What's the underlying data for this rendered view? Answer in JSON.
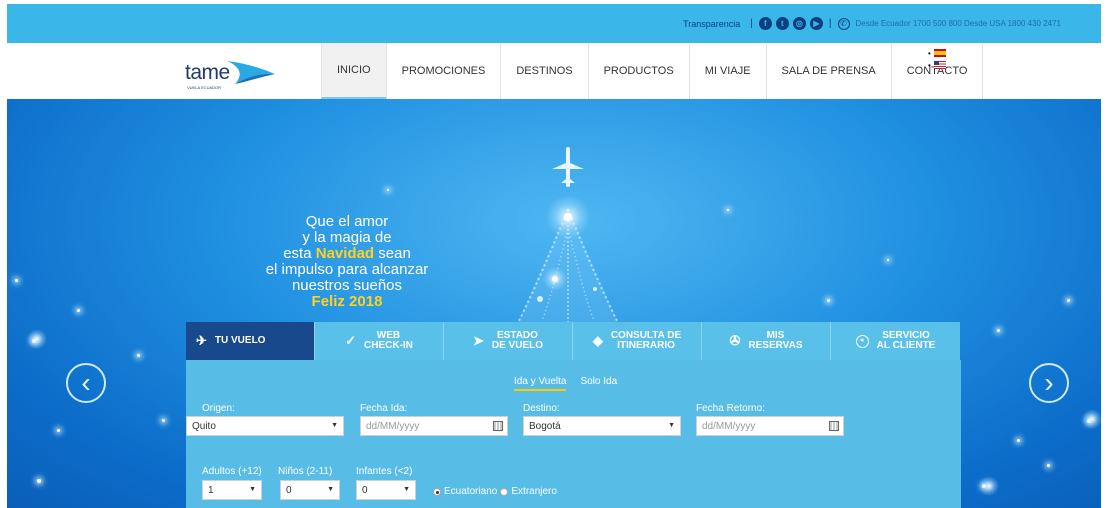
{
  "topbar": {
    "transparencia": "Transparencia",
    "social": [
      {
        "icon": "facebook-icon",
        "glyph": "f"
      },
      {
        "icon": "twitter-icon",
        "glyph": "t"
      },
      {
        "icon": "instagram-icon",
        "glyph": "◎"
      },
      {
        "icon": "youtube-icon",
        "glyph": "▶"
      }
    ],
    "phone_text": "Desde Ecuador 1700 500 800 Desde USA 1800 430 2471"
  },
  "nav": {
    "logo_text": "tame",
    "logo_tagline": "VUELA ECUADOR",
    "items": [
      "INICIO",
      "PROMOCIONES",
      "DESTINOS",
      "PRODUCTOS",
      "MI VIAJE",
      "SALA DE PRENSA",
      "CONTACTO"
    ],
    "active_index": 0,
    "languages": [
      "es-flag",
      "us-flag"
    ]
  },
  "hero": {
    "line1": "Que el amor",
    "line2": "y la magia de",
    "line3_pre": "esta ",
    "line3_hl": "Navidad",
    "line3_post": " sean",
    "line4": "el impulso para alcanzar",
    "line5": "nuestros sueños",
    "line6": "Feliz 2018",
    "prev": "‹",
    "next": "›"
  },
  "booking": {
    "tabs": [
      {
        "label1": "TU VUELO",
        "label2": "",
        "icon": "seat-icon",
        "glyph": "💺"
      },
      {
        "label1": "WEB",
        "label2": "CHECK-IN",
        "icon": "check-icon",
        "glyph": "✓"
      },
      {
        "label1": "ESTADO",
        "label2": "DE VUELO",
        "icon": "plane-icon",
        "glyph": "➤"
      },
      {
        "label1": "CONSULTA DE",
        "label2": "ITINERARIO",
        "icon": "ticket-icon",
        "glyph": "◆"
      },
      {
        "label1": "MIS",
        "label2": "RESERVAS",
        "icon": "reservations-icon",
        "glyph": "✇"
      },
      {
        "label1": "SERVICIO",
        "label2": "AL CLIENTE",
        "icon": "customer-service-icon",
        "glyph": "☺"
      }
    ],
    "trip_types": [
      "Ida y Vuelta",
      "Solo Ida"
    ],
    "origen_label": "Origen:",
    "origen_value": "Quito",
    "fecha_ida_label": "Fecha Ida:",
    "fecha_ida_placeholder": "dd/MM/yyyy",
    "destino_label": "Destino:",
    "destino_value": "Bogotá",
    "fecha_retorno_label": "Fecha Retorno:",
    "fecha_retorno_placeholder": "dd/MM/yyyy",
    "adultos_label": "Adultos (+12)",
    "adultos_value": "1",
    "ninos_label": "Niños (2-11)",
    "ninos_value": "0",
    "infantes_label": "Infantes (<2)",
    "infantes_value": "0",
    "nationality": [
      "Ecuatoriano",
      "Extranjero"
    ]
  }
}
